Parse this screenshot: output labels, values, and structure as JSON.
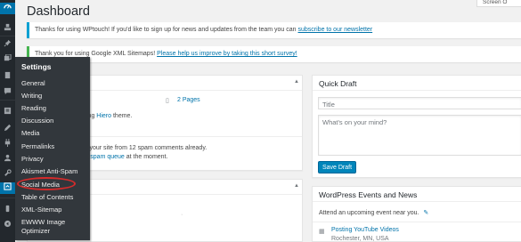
{
  "page": {
    "title": "Dashboard",
    "screen_options": "Screen O"
  },
  "notices": {
    "wptouch_text": "Thanks for using WPtouch! If you'd like to sign up for news and updates from the team you can ",
    "wptouch_link": "subscribe to our newsletter",
    "sitemaps_text": "Thank you for using Google XML Sitemaps! ",
    "sitemaps_link": "Please help us improve by taking this short survey!"
  },
  "sidebar": {
    "settings_title": "Settings",
    "settings_items": [
      "General",
      "Writing",
      "Reading",
      "Discussion",
      "Media",
      "Permalinks",
      "Privacy",
      "Akismet Anti-Spam",
      "Social Media",
      "Table of Contents",
      "XML-Sitemap",
      "EWWW Image",
      "Optimizer"
    ]
  },
  "glance": {
    "pages": "2 Pages",
    "theme_pre": "ing ",
    "theme_link": "Hiero",
    "theme_post": " theme.",
    "spam_line1": "l your site from 12 spam comments already.",
    "spam_pre": "r ",
    "spam_link": "spam queue",
    "spam_post": " at the moment."
  },
  "quick_draft": {
    "heading": "Quick Draft",
    "title_placeholder": "Title",
    "content_placeholder": "What's on your mind?",
    "save_label": "Save Draft"
  },
  "events": {
    "heading": "WordPress Events and News",
    "attend_text": "Attend an upcoming event near you.",
    "event_title": "Posting YouTube Videos",
    "event_location": "Rochester, MN, USA"
  },
  "colors": {
    "accent": "#0073aa",
    "highlight_ring": "#d52b2b",
    "sidebar_bg": "#23282d"
  }
}
